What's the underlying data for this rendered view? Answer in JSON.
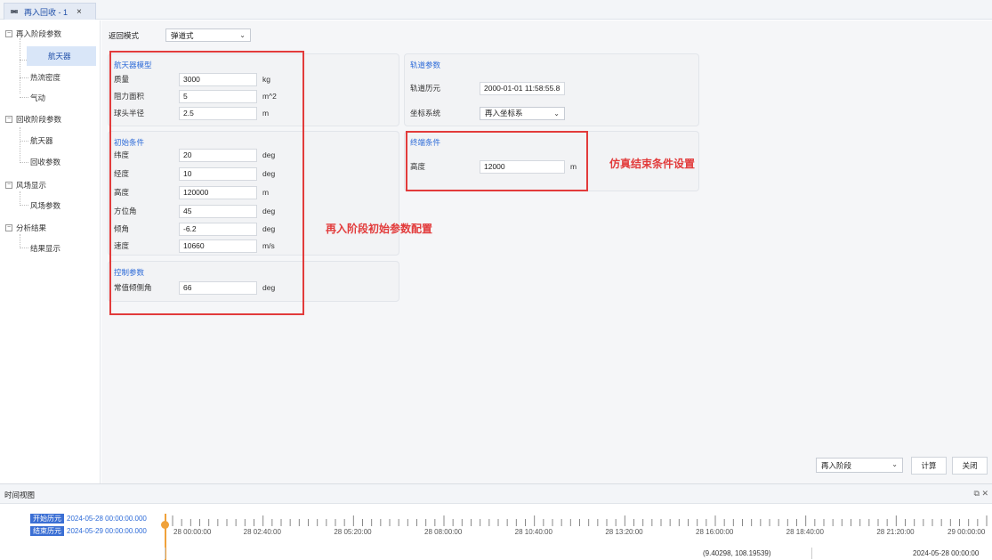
{
  "tab": {
    "label": "再入回收 - 1",
    "close": "×"
  },
  "sidebar": {
    "groups": [
      {
        "label": "再入阶段参数",
        "children": [
          "航天器",
          "热流密度",
          "气动"
        ]
      },
      {
        "label": "回收阶段参数",
        "children": [
          "航天器",
          "回收参数"
        ]
      },
      {
        "label": "风场显示",
        "children": [
          "风场参数"
        ]
      },
      {
        "label": "分析结果",
        "children": [
          "结果显示"
        ]
      }
    ],
    "expander": "−"
  },
  "main": {
    "mode_label": "返回模式",
    "mode_value": "弹道式",
    "spacecraft_model": {
      "title": "航天器模型",
      "fields": [
        {
          "label": "质量",
          "value": "3000",
          "unit": "kg"
        },
        {
          "label": "阻力面积",
          "value": "5",
          "unit": "m^2"
        },
        {
          "label": "球头半径",
          "value": "2.5",
          "unit": "m"
        }
      ]
    },
    "initial_conditions": {
      "title": "初始条件",
      "fields": [
        {
          "label": "纬度",
          "value": "20",
          "unit": "deg"
        },
        {
          "label": "经度",
          "value": "10",
          "unit": "deg"
        },
        {
          "label": "高度",
          "value": "120000",
          "unit": "m"
        },
        {
          "label": "方位角",
          "value": "45",
          "unit": "deg"
        },
        {
          "label": "倾角",
          "value": "-6.2",
          "unit": "deg"
        },
        {
          "label": "速度",
          "value": "10660",
          "unit": "m/s"
        }
      ]
    },
    "control_params": {
      "title": "控制参数",
      "fields": [
        {
          "label": "常值倾侧角",
          "value": "66",
          "unit": "deg"
        }
      ]
    },
    "orbit_params": {
      "title": "轨道参数",
      "epoch_label": "轨道历元",
      "epoch_value": "2000-01-01 11:58:55.8",
      "frame_label": "坐标系统",
      "frame_value": "再入坐标系"
    },
    "termination": {
      "title": "终端条件",
      "fields": [
        {
          "label": "高度",
          "value": "12000",
          "unit": "m"
        }
      ]
    },
    "annotation_sim_end": "仿真结束条件设置",
    "annotation_reentry_init": "再入阶段初始参数配置",
    "stage_select": "再入阶段",
    "calc_button": "计算",
    "close_button": "关闭"
  },
  "timeview": {
    "title": "时间视图",
    "start_label": "开始历元",
    "start_value": "2024-05-28 00:00:00.000",
    "end_label": "结束历元",
    "end_value": "2024-05-29 00:00:00.000",
    "ticks": [
      "28 00:00:00",
      "28 02:40:00",
      "28 05:20:00",
      "28 08:00:00",
      "28 10:40:00",
      "28 13:20:00",
      "28 16:00:00",
      "28 18:40:00",
      "28 21:20:00",
      "29 00:00:00"
    ],
    "coords": "(9.40298, 108.19539)",
    "current_time": "2024-05-28 00:00:00"
  },
  "colors": {
    "accent": "#2d6bd8",
    "annotation": "#e23b3b",
    "playhead": "#f0a23a"
  }
}
